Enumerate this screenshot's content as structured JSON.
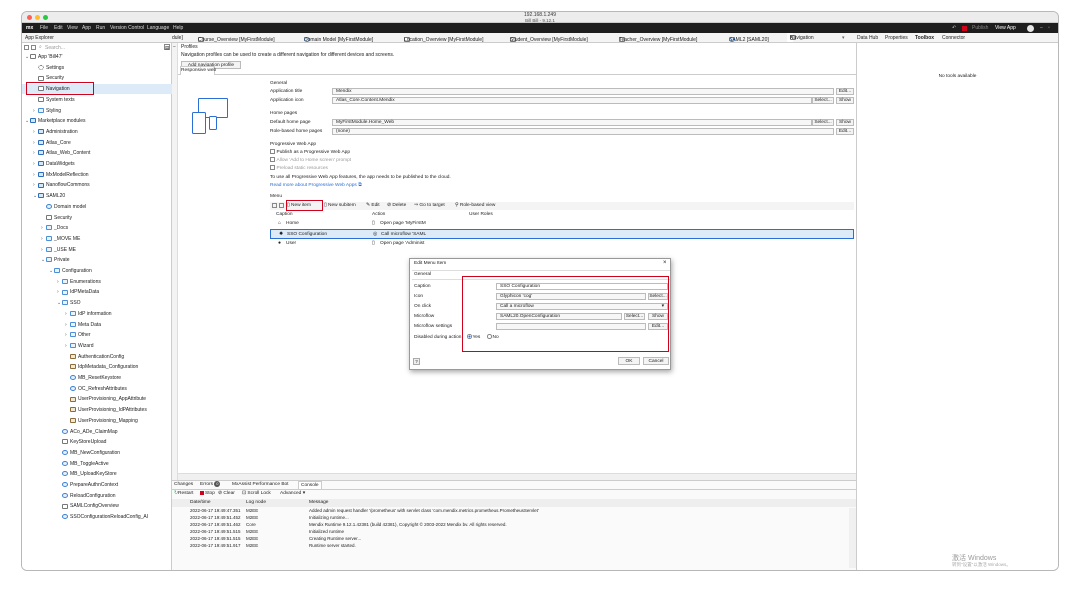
{
  "window": {
    "title": "192.168.1.249",
    "subtitle": "Bill Bill - 9.12.1"
  },
  "colors": {
    "accent": "#2b6fd6",
    "highlight": "#d0021b",
    "menubar": "#1e1e1e",
    "selection": "#ddeaf8"
  },
  "menubar": {
    "logo": "mx",
    "items": [
      "File",
      "Edit",
      "View",
      "App",
      "Run",
      "Version Control",
      "Language",
      "Help"
    ],
    "right": {
      "publish": "Publish",
      "view_app": "View App",
      "user_initial": "B"
    }
  },
  "tabs": {
    "left_title": "App Explorer",
    "first_tab": "dule]",
    "items": [
      {
        "label": "Course_Overview [MyFirstModule]",
        "active": false
      },
      {
        "label": "Domain Model [MyFirstModule]",
        "active": false
      },
      {
        "label": "Location_Overview [MyFirstModule]",
        "active": false
      },
      {
        "label": "Student_Overview [MyFirstModule]",
        "active": false
      },
      {
        "label": "Teacher_Overview [MyFirstModule]",
        "active": false
      },
      {
        "label": "SAML2 [SAML20]",
        "active": false
      },
      {
        "label": "Navigation",
        "active": true
      }
    ],
    "right_tabs": [
      "Data Hub",
      "Properties",
      "Toolbox",
      "Connector"
    ]
  },
  "explorer": {
    "search_placeholder": "Search...",
    "items": [
      {
        "label": "App 'Bill47'",
        "level": 0,
        "chevron": "v",
        "icon": "doc"
      },
      {
        "label": "Settings",
        "level": 1,
        "chevron": "",
        "icon": "gear"
      },
      {
        "label": "Security",
        "level": 1,
        "chevron": "",
        "icon": "doc"
      },
      {
        "label": "Navigation",
        "level": 1,
        "chevron": "",
        "icon": "doc",
        "selected": true
      },
      {
        "label": "System texts",
        "level": 1,
        "chevron": "",
        "icon": "doc"
      },
      {
        "label": "Styling",
        "level": 1,
        "chevron": ">",
        "icon": "folder"
      },
      {
        "label": "Marketplace modules",
        "level": 0,
        "chevron": "v",
        "icon": "mod"
      },
      {
        "label": "Administration",
        "level": 1,
        "chevron": ">",
        "icon": "mod"
      },
      {
        "label": "Atlas_Core",
        "level": 1,
        "chevron": ">",
        "icon": "mod"
      },
      {
        "label": "Atlas_Web_Content",
        "level": 1,
        "chevron": ">",
        "icon": "mod"
      },
      {
        "label": "DataWidgets",
        "level": 1,
        "chevron": ">",
        "icon": "mod"
      },
      {
        "label": "MxModelReflection",
        "level": 1,
        "chevron": ">",
        "icon": "mod"
      },
      {
        "label": "NanoflowCommons",
        "level": 1,
        "chevron": ">",
        "icon": "mod"
      },
      {
        "label": "SAML20",
        "level": 1,
        "chevron": "v",
        "icon": "mod"
      },
      {
        "label": "Domain model",
        "level": 2,
        "chevron": "",
        "icon": "circ"
      },
      {
        "label": "Security",
        "level": 2,
        "chevron": "",
        "icon": "doc"
      },
      {
        "label": "_Docs",
        "level": 2,
        "chevron": ">",
        "icon": "folder"
      },
      {
        "label": "_MOVE ME",
        "level": 2,
        "chevron": ">",
        "icon": "folder"
      },
      {
        "label": "_USE ME",
        "level": 2,
        "chevron": ">",
        "icon": "folder"
      },
      {
        "label": "Private",
        "level": 2,
        "chevron": "v",
        "icon": "folder"
      },
      {
        "label": "Configuration",
        "level": 3,
        "chevron": "v",
        "icon": "folder"
      },
      {
        "label": "Enumerations",
        "level": 4,
        "chevron": ">",
        "icon": "folder"
      },
      {
        "label": "IdPMetaData",
        "level": 4,
        "chevron": ">",
        "icon": "folder"
      },
      {
        "label": "SSO",
        "level": 4,
        "chevron": "v",
        "icon": "folder"
      },
      {
        "label": "IdP information",
        "level": 5,
        "chevron": ">",
        "icon": "folder"
      },
      {
        "label": "Meta Data",
        "level": 5,
        "chevron": ">",
        "icon": "folder"
      },
      {
        "label": "Other",
        "level": 5,
        "chevron": ">",
        "icon": "folder"
      },
      {
        "label": "Wizard",
        "level": 5,
        "chevron": ">",
        "icon": "folder"
      },
      {
        "label": "AuthenticationConfig",
        "level": 5,
        "chevron": "",
        "icon": "brown"
      },
      {
        "label": "IdpMetadata_Configuration",
        "level": 5,
        "chevron": "",
        "icon": "brown"
      },
      {
        "label": "MB_ResetKeystore",
        "level": 5,
        "chevron": "",
        "icon": "circ"
      },
      {
        "label": "OC_RefreshAttributes",
        "level": 5,
        "chevron": "",
        "icon": "circ"
      },
      {
        "label": "UserProvisioning_AppAttribute",
        "level": 5,
        "chevron": "",
        "icon": "brown"
      },
      {
        "label": "UserProvisioning_IdPAttributes",
        "level": 5,
        "chevron": "",
        "icon": "brown"
      },
      {
        "label": "UserProvisioning_Mapping",
        "level": 5,
        "chevron": "",
        "icon": "brown"
      },
      {
        "label": "ACo_ADe_ClaimMap",
        "level": 4,
        "chevron": "",
        "icon": "circ"
      },
      {
        "label": "KeyStoreUpload",
        "level": 4,
        "chevron": "",
        "icon": "doc"
      },
      {
        "label": "MB_NewConfiguration",
        "level": 4,
        "chevron": "",
        "icon": "circ"
      },
      {
        "label": "MB_ToggleActive",
        "level": 4,
        "chevron": "",
        "icon": "circ"
      },
      {
        "label": "MB_UploadKeyStore",
        "level": 4,
        "chevron": "",
        "icon": "circ"
      },
      {
        "label": "PrepareAuthnContext",
        "level": 4,
        "chevron": "",
        "icon": "circ"
      },
      {
        "label": "ReloadConfiguration",
        "level": 4,
        "chevron": "",
        "icon": "circ"
      },
      {
        "label": "SAMLConfigOverview",
        "level": 4,
        "chevron": "",
        "icon": "doc"
      },
      {
        "label": "SSOConfigurationReloadConfig_AI",
        "level": 4,
        "chevron": "",
        "icon": "circ"
      }
    ]
  },
  "profiles": {
    "title": "Profiles",
    "description": "Navigation profiles can be used to create a different navigation for different devices and screens.",
    "add_button": "Add navigation profile",
    "tab": "Responsive web"
  },
  "general": {
    "heading": "General",
    "title_label": "Application title",
    "title_value": "Mendix",
    "icon_label": "Application icon",
    "icon_value": "Atlas_Core.Content.Mendix",
    "edit": "Edit...",
    "select": "Select...",
    "show": "Show"
  },
  "homepages": {
    "heading": "Home pages",
    "default_label": "Default home page",
    "default_value": "MyFirstModule.Home_Web",
    "role_label": "Role-based home pages",
    "role_value": "(none)"
  },
  "pwa": {
    "heading": "Progressive Web App",
    "options": [
      "Publish as a Progressive Web App",
      "Allow 'Add to Home screen' prompt",
      "Preload static resources"
    ],
    "note": "To use all Progressive Web App features, the app needs to be published to the cloud.",
    "link": "Read more about Progressive Web Apps"
  },
  "menu": {
    "heading": "Menu",
    "toolbar": {
      "new_item": "New item",
      "new_subitem": "New subitem",
      "edit": "Edit",
      "delete": "Delete",
      "go_to_target": "Go to target",
      "role_view": "Role-based view"
    },
    "columns": {
      "caption": "Caption",
      "action": "Action",
      "roles": "User Roles"
    },
    "rows": [
      {
        "caption": "Home",
        "action": "Open page 'MyFirstM",
        "icon": "home"
      },
      {
        "caption": "SSO Configuration",
        "action": "Call microflow 'SAML",
        "icon": "gear",
        "selected": true
      },
      {
        "caption": "User",
        "action": "Open page 'Administ",
        "icon": "user"
      }
    ]
  },
  "dialog": {
    "title": "Edit Menu Item",
    "tab": "General",
    "fields": [
      {
        "label": "Caption",
        "value": "SSO Configuration"
      },
      {
        "label": "Icon",
        "value": "Glyphicon 'cog'",
        "button": "Select..."
      },
      {
        "label": "On click",
        "value": "Call a microflow",
        "dropdown": true
      },
      {
        "label": "Microflow",
        "value": "SAML20.OpenConfiguration",
        "button": "Select...",
        "button2": "Show"
      },
      {
        "label": "Microflow settings",
        "value": "",
        "button": "Edit..."
      }
    ],
    "disabled_label": "Disabled during action",
    "yes": "Yes",
    "no": "No",
    "ok": "OK",
    "cancel": "Cancel"
  },
  "bottom": {
    "tabs": [
      "Changes",
      "Errors",
      "MxAssist Performance Bot",
      "Console"
    ],
    "active_tab": "Console",
    "error_count": "0",
    "toolbar": {
      "restart": "Restart",
      "stop": "Stop",
      "clear": "Clear",
      "scroll_lock": "Scroll Lock",
      "advanced": "Advanced"
    },
    "columns": {
      "time": "Date/time",
      "node": "Log node",
      "message": "Message"
    },
    "logs": [
      {
        "time": "2022-06-17 19:49:47.351",
        "node": "M2EE",
        "message": "Added admin request handler '/prometheus' with servlet class 'com.mendix.metrics.prometheus.PrometheusServlet'"
      },
      {
        "time": "2022-06-17 19:49:51.452",
        "node": "M2EE",
        "message": "Initializing runtime..."
      },
      {
        "time": "2022-06-17 19:49:51.462",
        "node": "Core",
        "message": "Mendix Runtime 9.12.1.42381 (build 42381), Copyright © 2003-2022 Mendix bv. All rights reserved."
      },
      {
        "time": "2022-06-17 19:49:51.515",
        "node": "M2EE",
        "message": "Initialized runtime"
      },
      {
        "time": "2022-06-17 19:49:51.515",
        "node": "M2EE",
        "message": "Creating Runtime server..."
      },
      {
        "time": "2022-06-17 19:49:51.917",
        "node": "M2EE",
        "message": "Runtime server started."
      }
    ]
  },
  "right": {
    "no_tools": "No tools available",
    "watermark_title": "激活 Windows",
    "watermark_sub": "转到\"设置\"以激活 Windows。"
  }
}
